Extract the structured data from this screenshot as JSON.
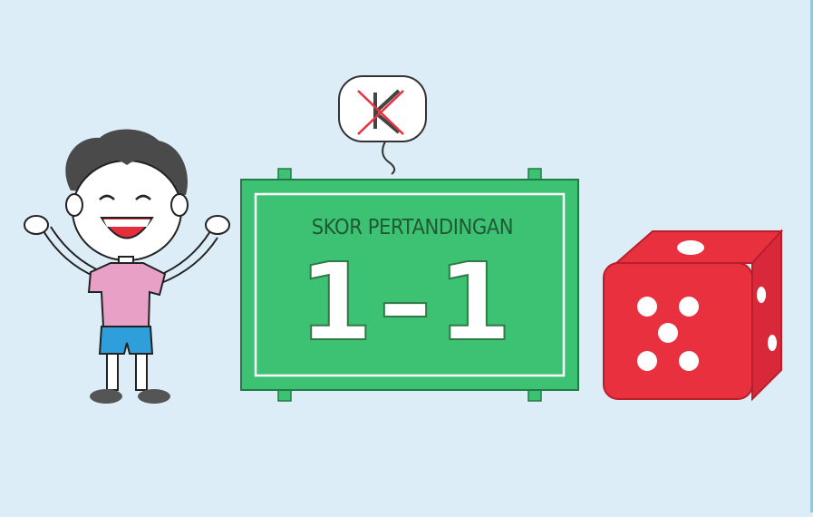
{
  "scoreboard": {
    "title": "SKOR PERTANDINGAN",
    "score": "1–1"
  },
  "speech_bubble": {
    "glyph": "K"
  },
  "colors": {
    "background": "#dcedf7",
    "board_green": "#3cc272",
    "dice_red": "#e8303f",
    "shirt_pink": "#e9a0c6",
    "shorts_blue": "#2f9fdc"
  },
  "icons": [
    "cheering-boy-icon",
    "speech-bubble-icon",
    "scoreboard-icon",
    "dice-icon"
  ],
  "dice": {
    "front_face_value": 5
  }
}
